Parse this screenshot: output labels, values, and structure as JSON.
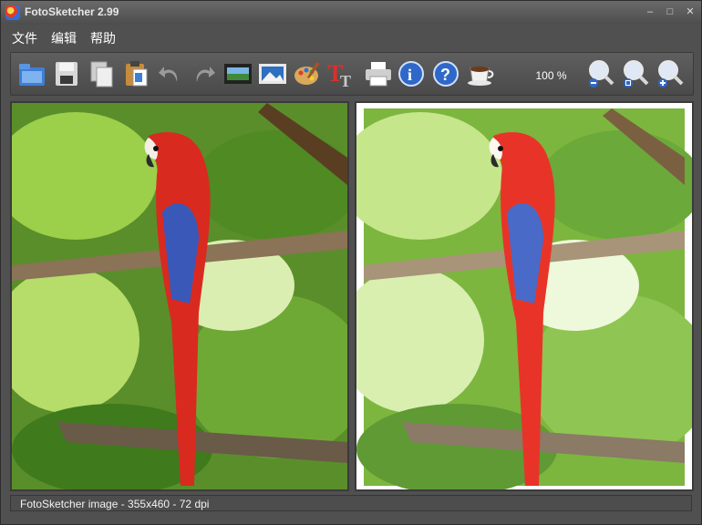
{
  "window": {
    "title": "FotoSketcher 2.99"
  },
  "menu": {
    "items": [
      "文件",
      "编辑",
      "帮助"
    ]
  },
  "toolbar": {
    "zoom_value": "100 %",
    "tools": [
      "open-folder-icon",
      "save-icon",
      "copy-icon",
      "paste-icon",
      "undo-icon",
      "redo-icon",
      "filmstrip-icon",
      "landscape-icon",
      "palette-icon",
      "text-icon",
      "print-icon",
      "info-icon",
      "help-icon",
      "coffee-icon",
      "zoom-out-icon",
      "zoom-fit-icon",
      "zoom-in-icon"
    ]
  },
  "status": {
    "text": "FotoSketcher image - 355x460 - 72 dpi"
  },
  "colors": {
    "accent_blue": "#2f68c8",
    "chrome": "#505050"
  }
}
